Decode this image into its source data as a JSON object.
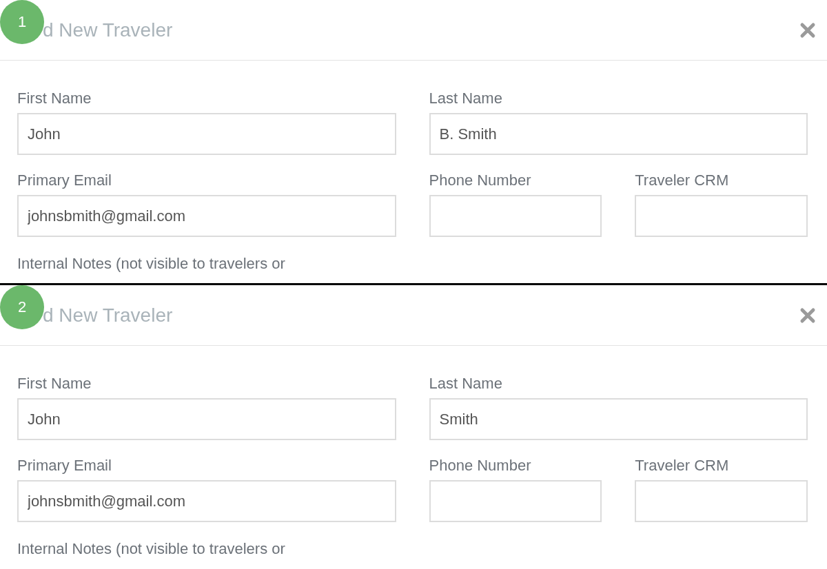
{
  "panels": [
    {
      "step": "1",
      "title": "d New Traveler",
      "fields": [
        {
          "label": "First Name",
          "value": "John"
        },
        {
          "label": "Last Name",
          "value": "B. Smith"
        },
        {
          "label": "Primary Email",
          "value": "johnsbmith@gmail.com"
        },
        {
          "label": "Phone Number"
        },
        {
          "label": "Traveler CRM"
        }
      ],
      "notes_label": "Internal Notes (not visible to travelers or"
    },
    {
      "step": "2",
      "title": "d New Traveler",
      "fields": [
        {
          "label": "First Name",
          "value": "John"
        },
        {
          "label": "Last Name",
          "value": "Smith"
        },
        {
          "label": "Primary Email",
          "value": "johnsbmith@gmail.com"
        },
        {
          "label": "Phone Number"
        },
        {
          "label": "Traveler CRM"
        }
      ],
      "notes_label": "Internal Notes (not visible to travelers or"
    }
  ]
}
